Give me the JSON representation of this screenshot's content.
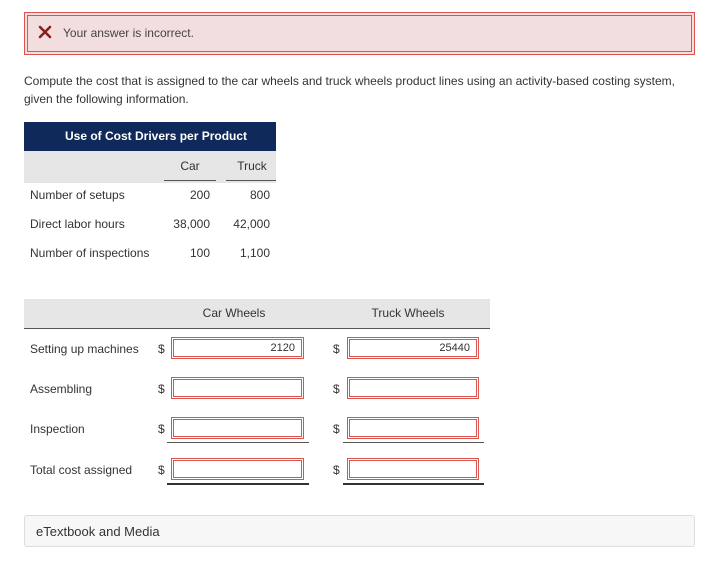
{
  "alert": {
    "icon": "x-icon",
    "message": "Your answer is incorrect.",
    "color": "#d9534f",
    "background": "#f2dede"
  },
  "question": "Compute the cost that is assigned to the car wheels and truck wheels product lines using an activity-based costing system, given the following information.",
  "drivers_table": {
    "title": "Use of Cost Drivers per Product",
    "columns": [
      "Car",
      "Truck"
    ],
    "rows": [
      {
        "label": "Number of setups",
        "car": "200",
        "truck": "800"
      },
      {
        "label": "Direct labor hours",
        "car": "38,000",
        "truck": "42,000"
      },
      {
        "label": "Number of inspections",
        "car": "100",
        "truck": "1,100"
      }
    ],
    "header_color": "#0f2a5a"
  },
  "answer_table": {
    "columns": [
      "Car Wheels",
      "Truck Wheels"
    ],
    "currency": "$",
    "rows": [
      {
        "label": "Setting up machines",
        "car_value": "2120",
        "truck_value": "25440"
      },
      {
        "label": "Assembling",
        "car_value": "",
        "truck_value": ""
      },
      {
        "label": "Inspection",
        "car_value": "",
        "truck_value": ""
      },
      {
        "label": "Total cost assigned",
        "car_value": "",
        "truck_value": ""
      }
    ]
  },
  "etextbook": {
    "label": "eTextbook and Media"
  }
}
